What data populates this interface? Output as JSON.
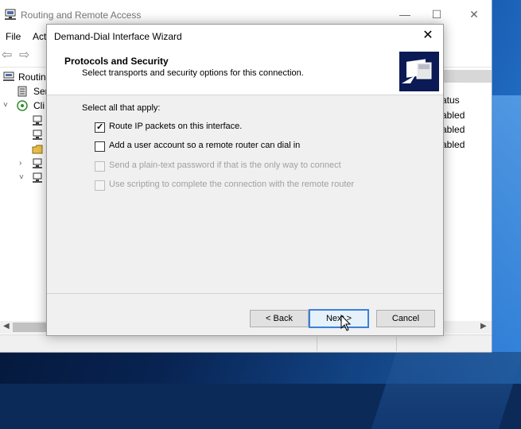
{
  "main_window": {
    "title": "Routing and Remote Access",
    "menu": [
      "File",
      "Act"
    ],
    "caption_buttons": {
      "minimize": "—",
      "maximize": "☐",
      "close": "✕"
    },
    "tree": [
      {
        "label": "Routin",
        "icon": "server-icon",
        "expander": ""
      },
      {
        "label": "Ser",
        "icon": "server-status-icon",
        "expander": ""
      },
      {
        "label": "Cli",
        "icon": "network-icon",
        "expander": "˅"
      },
      {
        "label": "",
        "icon": "interface-icon",
        "expander": ""
      },
      {
        "label": "",
        "icon": "interface-icon",
        "expander": ""
      },
      {
        "label": "",
        "icon": "folder-icon",
        "expander": ""
      },
      {
        "label": "",
        "icon": "interface-icon",
        "expander": "›"
      },
      {
        "label": "",
        "icon": "interface-icon",
        "expander": "˅"
      }
    ],
    "list": {
      "column": "atus",
      "rows": [
        "abled",
        "abled",
        "abled"
      ]
    }
  },
  "wizard": {
    "title": "Demand-Dial Interface Wizard",
    "close_glyph": "✕",
    "header_title": "Protocols and Security",
    "header_subtitle": "Select transports and security options for this connection.",
    "prompt": "Select all that apply:",
    "options": [
      {
        "label": "Route IP packets on this interface.",
        "checked": true,
        "enabled": true
      },
      {
        "label": "Add a user account so a remote router can dial in",
        "checked": false,
        "enabled": true
      },
      {
        "label": "Send a plain-text password if that is the only way to connect",
        "checked": false,
        "enabled": false
      },
      {
        "label": "Use scripting to complete the connection with the remote router",
        "checked": false,
        "enabled": false
      }
    ],
    "buttons": {
      "back": "< Back",
      "next": "Next >",
      "cancel": "Cancel"
    }
  },
  "colors": {
    "accent": "#3c7fd8",
    "header_graphic": "#0b1a55",
    "disabled_text": "#a0a0a0"
  }
}
